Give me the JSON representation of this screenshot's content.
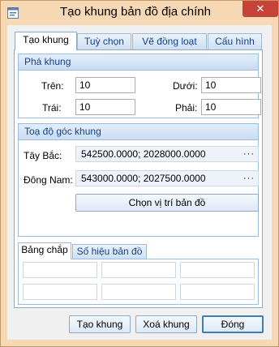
{
  "window": {
    "title": "Tạo khung bản đồ địa chính",
    "close_glyph": "✕"
  },
  "tabs": [
    {
      "label": "Tạo khung",
      "active": true
    },
    {
      "label": "Tuỳ chọn",
      "active": false
    },
    {
      "label": "Vẽ đồng loạt",
      "active": false
    },
    {
      "label": "Cấu hình",
      "active": false
    }
  ],
  "pha_khung": {
    "header": "Phá khung",
    "tren_label": "Trên:",
    "tren_value": "10",
    "duoi_label": "Dưới:",
    "duoi_value": "10",
    "trai_label": "Trái:",
    "trai_value": "10",
    "phai_label": "Phải:",
    "phai_value": "10"
  },
  "toa_do": {
    "header": "Toạ độ góc khung",
    "tay_bac_label": "Tây Bắc:",
    "tay_bac_value": "542500.0000; 2028000.0000",
    "dong_nam_label": "Đông Nam:",
    "dong_nam_value": "543000.0000; 2027500.0000",
    "ellipsis": "···",
    "chon_vi_tri_button": "Chọn vị trí bản đồ"
  },
  "subtabs": [
    {
      "label": "Bảng chắp",
      "active": true
    },
    {
      "label": "Số hiệu bản đồ",
      "active": false
    }
  ],
  "bang_chap_cells": [
    "",
    "",
    "",
    "",
    "",
    "",
    "",
    "",
    ""
  ],
  "footer": {
    "tao_khung_button": "Tạo khung",
    "xoa_khung_button": "Xoá khung",
    "dong_button": "Đóng"
  },
  "colors": {
    "window_frame": "#f6d9b4",
    "close_button": "#c7433a",
    "group_header_text": "#15428b",
    "group_border": "#99bbe8"
  },
  "icons": {
    "app_icon": "form-window-icon",
    "close_icon": "close-icon"
  }
}
